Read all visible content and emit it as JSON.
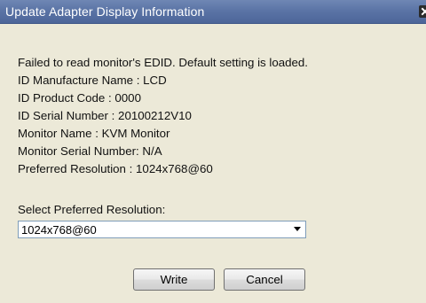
{
  "window": {
    "title": "Update Adapter Display Information"
  },
  "info_lines": [
    "Failed to read monitor's EDID. Default setting is loaded.",
    "ID Manufacture Name : LCD",
    "ID Product Code : 0000",
    "ID Serial Number : 20100212V10",
    "Monitor Name : KVM Monitor",
    "Monitor Serial Number: N/A",
    "Preferred Resolution : 1024x768@60"
  ],
  "resolution_select": {
    "label": "Select Preferred Resolution:",
    "selected_value": "1024x768@60"
  },
  "buttons": {
    "write_label": "Write",
    "cancel_label": "Cancel"
  },
  "icons": {
    "close": "close-icon",
    "dropdown": "chevron-down-icon"
  },
  "colors": {
    "titlebar": "#5b74a6",
    "dialog_background": "#ece9d8",
    "select_border": "#7f9db9"
  }
}
